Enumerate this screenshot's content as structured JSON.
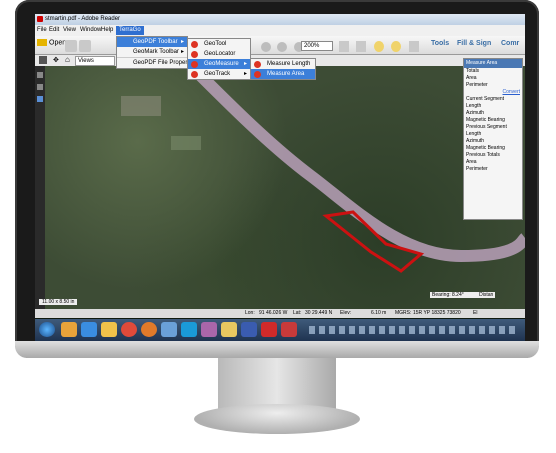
{
  "window": {
    "title": "stmartin.pdf - Adobe Reader"
  },
  "menubar": [
    "File",
    "Edit",
    "View",
    "Window",
    "Help",
    "TerraGo"
  ],
  "toolbar": {
    "open_label": "Open",
    "zoom_value": "200%",
    "tools_label": "Tools",
    "fill_sign_label": "Fill & Sign",
    "comment_label": "Comr"
  },
  "toolbar2": {
    "views_label": "Views"
  },
  "terrago_menu": [
    {
      "label": "GeoPDF Toolbar",
      "has_submenu": true
    },
    {
      "label": "GeoMark Toolbar",
      "has_submenu": true
    },
    {
      "label": "GeoPDF File Properties",
      "has_submenu": false
    }
  ],
  "geopdf_submenu": [
    {
      "label": "GeoTool",
      "icon": "geotool-icon"
    },
    {
      "label": "GeoLocator",
      "icon": "geolocator-icon"
    },
    {
      "label": "GeoMeasure",
      "icon": "geomeasure-icon"
    },
    {
      "label": "GeoTrack",
      "icon": "geotrack-icon"
    }
  ],
  "geomeasure_submenu": [
    {
      "label": "Measure Length"
    },
    {
      "label": "Measure Area"
    }
  ],
  "measure_panel": {
    "title": "Measure Area",
    "rows": [
      "Totals",
      "Area",
      "Perimeter",
      "Convert",
      "Current Segment",
      "Length",
      "Azimuth",
      "Magnetic Bearing",
      "Previous Segment",
      "Length",
      "Azimuth",
      "Magnetic Bearing",
      "Previous Totals",
      "Area",
      "Perimeter"
    ]
  },
  "bearing_label": "Bearing:",
  "bearing_value": "8.24°",
  "distance_label": "Distan",
  "page_size": "11.00 x 8.50 in",
  "statusbar": {
    "lon_label": "Lon:",
    "lon_value": "91 46.026 W",
    "lat_label": "Lat:",
    "lat_value": "30 29.449 N",
    "elev_label": "Elev:",
    "elev_value": "6.10 m",
    "mgrs_label": "MGRS:",
    "mgrs_value": "15R YP 18325 73820",
    "extra": "El"
  },
  "colors": {
    "accent": "#3c7fd9",
    "polygon": "#cc1111",
    "river": "#b9a0b8"
  }
}
